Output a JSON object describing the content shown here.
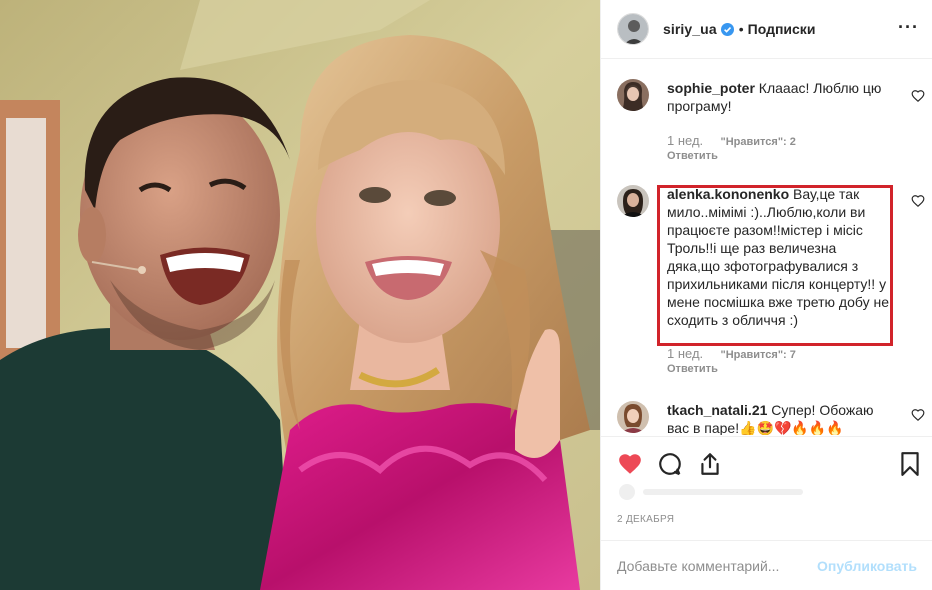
{
  "post": {
    "photo_alt": "",
    "header": {
      "username": "siriy_ua",
      "dot": "•",
      "follow_label": "Подписки",
      "more_label": "···"
    },
    "comments": [
      {
        "username": "sophie_poter",
        "text": "Клааас! Люблю цю програму!",
        "time": "1 нед.",
        "likes": "\"Нравится\": 2",
        "reply": "Ответить"
      },
      {
        "username": "alenka.kononenko",
        "text": "Вау,це так мило..мімімі :)..Люблю,коли ви працюєте разом!!містер і місіс Троль!!і ще раз величезна дяка,що зфотографувалися з прихильниками після концерту!! у мене посмішка вже третю добу не сходить з обличчя :)",
        "time": "1 нед.",
        "likes": "\"Нравится\": 7",
        "reply": "Ответить"
      },
      {
        "username": "tkach_natali.21",
        "text": "Супер! Обожаю вас в паре!👍🤩💔🔥🔥🔥",
        "time": "",
        "likes": "",
        "reply": ""
      }
    ],
    "date": "2 ДЕКАБРЯ",
    "composer": {
      "placeholder": "Добавьте комментарий...",
      "post_label": "Опубликовать"
    },
    "icons": {
      "like": "heart-filled-icon",
      "comment": "comment-icon",
      "share": "share-icon",
      "save": "bookmark-icon",
      "verified": "verified-badge-icon"
    },
    "colors": {
      "like_red": "#ed4956",
      "highlight_red": "#d1232a",
      "verified_blue": "#3897f0",
      "post_button_disabled": "#b2dffc",
      "muted_text": "#8e8e8e"
    }
  }
}
